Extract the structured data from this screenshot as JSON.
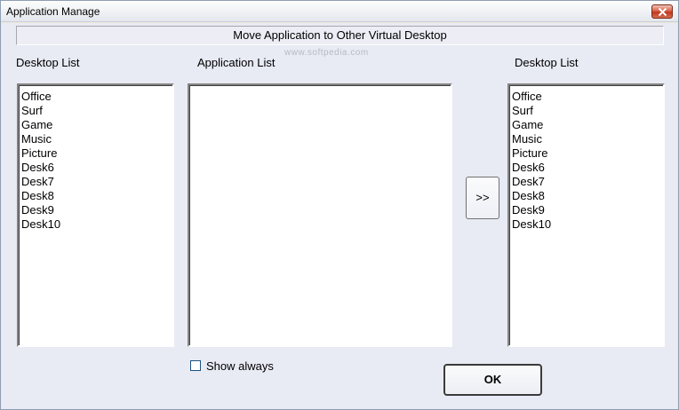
{
  "window": {
    "title": "Application Manage"
  },
  "header": {
    "title": "Move Application to Other Virtual Desktop",
    "watermark": "www.softpedia.com"
  },
  "left_panel": {
    "label": "Desktop List",
    "items": [
      "Office",
      "Surf",
      "Game",
      "Music",
      "Picture",
      "Desk6",
      "Desk7",
      "Desk8",
      "Desk9",
      "Desk10"
    ]
  },
  "middle_panel": {
    "label": "Application List",
    "items": []
  },
  "right_panel": {
    "label": "Desktop List",
    "items": [
      "Office",
      "Surf",
      "Game",
      "Music",
      "Picture",
      "Desk6",
      "Desk7",
      "Desk8",
      "Desk9",
      "Desk10"
    ]
  },
  "move_button": {
    "label": ">>"
  },
  "show_always": {
    "label": "Show always",
    "checked": false
  },
  "ok_button": {
    "label": "OK"
  },
  "icons": {
    "close": "close-icon"
  }
}
